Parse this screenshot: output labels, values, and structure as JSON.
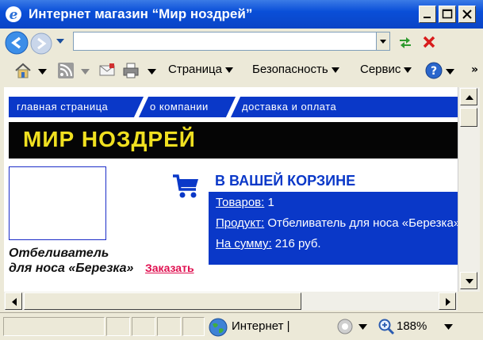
{
  "window": {
    "title": "Интернет магазин “Мир ноздрей”"
  },
  "address": {
    "value": ""
  },
  "commandbar": {
    "page_label": "Страница",
    "safety_label": "Безопасность",
    "tools_label": "Сервис"
  },
  "site": {
    "nav": [
      "главная страница",
      "о компании",
      "доставка и оплата"
    ],
    "title": "МИР НОЗДРЕЙ"
  },
  "product": {
    "name_line1": "Отбеливатель",
    "name_line2": "для носа «Березка»",
    "order_label": "Заказать"
  },
  "cart": {
    "title": "В ВАШЕЙ КОРЗИНЕ",
    "items_label": "Товаров:",
    "items_value": " 1",
    "product_label": "Продукт:",
    "product_value": " Отбеливатель для носа «Березка»",
    "sum_label": "На сумму:",
    "sum_value": " 216 руб."
  },
  "status": {
    "zone": "Интернет |",
    "zoom": "188%"
  },
  "colors": {
    "accent_blue": "#0a38c8",
    "banner_yellow": "#f0e020",
    "order_red": "#e01050"
  }
}
